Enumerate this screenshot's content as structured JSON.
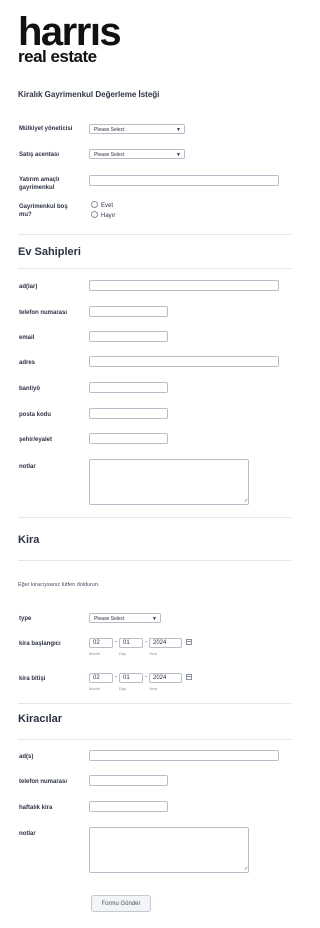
{
  "logo": {
    "main": "harrıs",
    "sub": "real estate"
  },
  "form": {
    "title": "Kiralık Gayrimenkul Değerleme İsteği",
    "property_manager": {
      "label": "Mülkiyet yöneticisi",
      "value": "Please Select"
    },
    "sales_agent": {
      "label": "Satış acentası",
      "value": "Please Select"
    },
    "investment": {
      "label": "Yatırım amaçlı gayrimenkul"
    },
    "vacant": {
      "label": "Gayrimenkul boş mu?",
      "options": [
        "Evet",
        "Hayır"
      ]
    }
  },
  "owners": {
    "heading": "Ev Sahipleri",
    "fields": {
      "name": "ad(lar)",
      "phone": "telefon numarası",
      "email": "email",
      "address": "adres",
      "suburb": "banliyö",
      "postcode": "posta kodu",
      "city": "şehir/eyalet",
      "notes": "notlar"
    }
  },
  "lease": {
    "heading": "Kira",
    "note": "Eğer kiracıysanız lütfen doldurun.",
    "type": {
      "label": "type",
      "value": "Please Select"
    },
    "start": {
      "label": "kira başlangıcı",
      "month": "02",
      "day": "01",
      "year": "2024"
    },
    "end": {
      "label": "kira bitişi",
      "month": "02",
      "day": "01",
      "year": "2024"
    },
    "sublabels": {
      "month": "Month",
      "day": "Day",
      "year": "Year"
    },
    "separator": "-"
  },
  "tenants": {
    "heading": "Kiracılar",
    "fields": {
      "name": "ad(s)",
      "phone": "telefon numarası",
      "weekly_rent": "haftalık kira",
      "notes": "notlar"
    }
  },
  "submit_label": "Formu Gönder",
  "icons": {
    "select": "chevron-down-icon",
    "calendar": "calendar-icon",
    "resize": "resize-grip-icon"
  }
}
